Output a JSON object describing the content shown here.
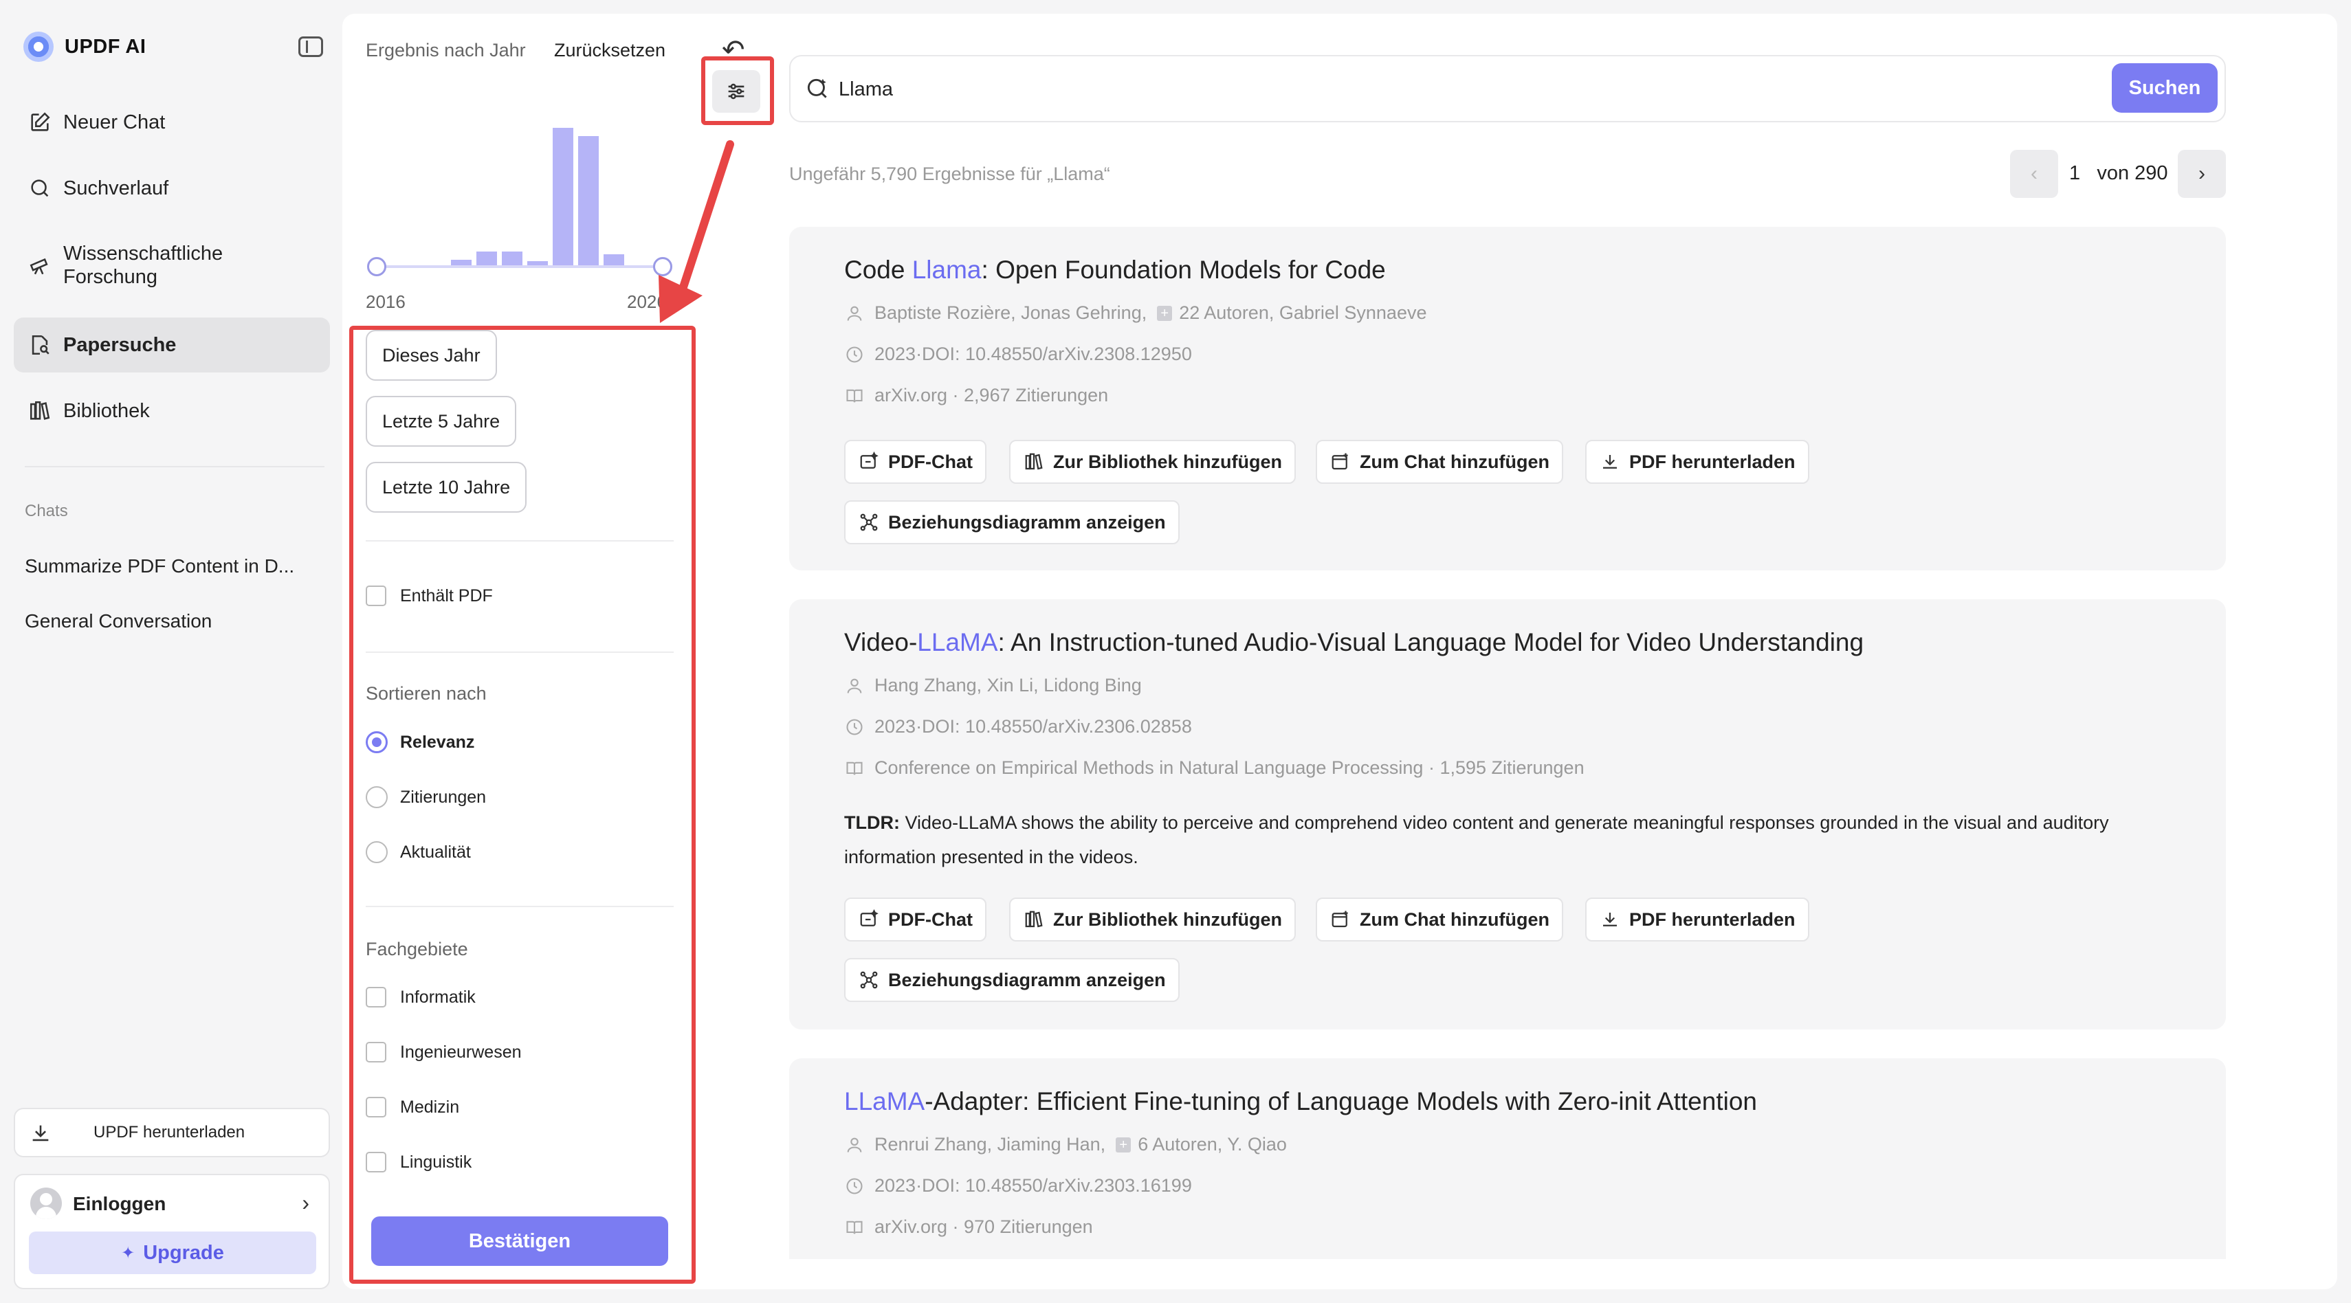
{
  "brand": {
    "name": "UPDF AI"
  },
  "sidebar": {
    "nav": [
      {
        "label": "Neuer Chat",
        "icon": "edit-icon"
      },
      {
        "label": "Suchverlauf",
        "icon": "search-icon"
      },
      {
        "label": "Wissenschaftliche Forschung",
        "icon": "telescope-icon"
      },
      {
        "label": "Papersuche",
        "icon": "paper-search-icon",
        "active": true
      },
      {
        "label": "Bibliothek",
        "icon": "library-icon"
      }
    ],
    "chats_label": "Chats",
    "chats": [
      "Summarize PDF Content in D...",
      "General Conversation"
    ],
    "download_label": "UPDF herunterladen",
    "login_label": "Einloggen",
    "upgrade_label": "Upgrade"
  },
  "filter": {
    "title": "Ergebnis nach Jahr",
    "reset": "Zurücksetzen",
    "year_start": "2016",
    "year_end": "2026",
    "histogram": [
      0,
      0,
      0.04,
      0.1,
      0.1,
      0.03,
      1.0,
      0.94,
      0.08
    ],
    "year_buttons": [
      "Dieses Jahr",
      "Letzte 5 Jahre",
      "Letzte 10 Jahre"
    ],
    "contains_pdf": "Enthält PDF",
    "sort_label": "Sortieren nach",
    "sort_options": [
      {
        "label": "Relevanz",
        "selected": true
      },
      {
        "label": "Zitierungen",
        "selected": false
      },
      {
        "label": "Aktualität",
        "selected": false
      }
    ],
    "fields_label": "Fachgebiete",
    "fields": [
      "Informatik",
      "Ingenieurwesen",
      "Medizin",
      "Linguistik"
    ],
    "confirm": "Bestätigen"
  },
  "search": {
    "query": "Llama",
    "button": "Suchen",
    "result_count": "Ungefähr 5,790 Ergebnisse für „Llama“",
    "page_current": "1",
    "page_total": "von 290"
  },
  "actions": {
    "pdf_chat": "PDF-Chat",
    "add_library": "Zur Bibliothek hinzufügen",
    "add_chat": "Zum Chat hinzufügen",
    "download_pdf": "PDF herunterladen",
    "relation_graph": "Beziehungsdiagramm anzeigen"
  },
  "results": [
    {
      "title_pre": "Code ",
      "title_hl": "Llama",
      "title_post": ": Open Foundation Models for Code",
      "authors": "Baptiste Rozière, Jonas Gehring,",
      "more_authors": "22 Autoren, Gabriel Synnaeve",
      "date_doi": "2023·DOI: 10.48550/arXiv.2308.12950",
      "venue": "arXiv.org · 2,967 Zitierungen"
    },
    {
      "title_pre": "Video-",
      "title_hl": "LLaMA",
      "title_post": ": An Instruction-tuned Audio-Visual Language Model for Video Understanding",
      "authors": "Hang Zhang, Xin Li, Lidong Bing",
      "date_doi": "2023·DOI: 10.48550/arXiv.2306.02858",
      "venue": "Conference on Empirical Methods in Natural Language Processing · 1,595 Zitierungen",
      "tldr_label": "TLDR:",
      "tldr": " Video-LLaMA shows the ability to perceive and comprehend video content and generate meaningful responses grounded in the visual and auditory information presented in the videos."
    },
    {
      "title_pre": "",
      "title_hl": "LLaMA",
      "title_post": "-Adapter: Efficient Fine-tuning of Language Models with Zero-init Attention",
      "authors": "Renrui Zhang, Jiaming Han,",
      "more_authors": "6 Autoren, Y. Qiao",
      "date_doi": "2023·DOI: 10.48550/arXiv.2303.16199",
      "venue": "arXiv.org · 970 Zitierungen"
    }
  ],
  "colors": {
    "accent": "#7b7cf2",
    "highlight": "#e74545"
  }
}
